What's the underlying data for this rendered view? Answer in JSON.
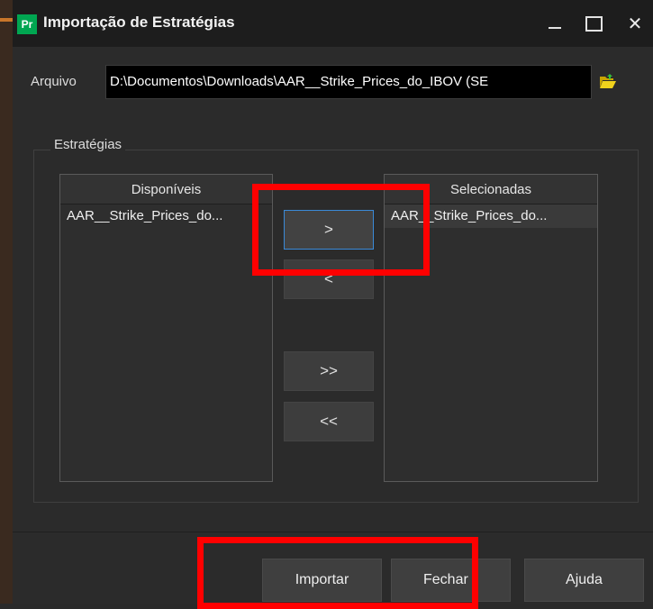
{
  "window": {
    "app_icon": "Pr",
    "title": "Importação de Estratégias"
  },
  "file": {
    "label": "Arquivo",
    "value": "D:\\Documentos\\Downloads\\AAR__Strike_Prices_do_IBOV (SE",
    "browse_icon": "folder-open-icon"
  },
  "strategies": {
    "group_title": "Estratégias",
    "available": {
      "header": "Disponíveis",
      "items": [
        "AAR__Strike_Prices_do..."
      ]
    },
    "selected": {
      "header": "Selecionadas",
      "items": [
        "AAR__Strike_Prices_do..."
      ]
    },
    "buttons": {
      "add": ">",
      "remove": "<",
      "add_all": ">>",
      "remove_all": "<<"
    }
  },
  "footer": {
    "import": "Importar",
    "close": "Fechar",
    "help": "Ajuda"
  },
  "colors": {
    "highlight": "#ff0000",
    "focus_border": "#3a8ad8",
    "app_icon_bg": "#00a651"
  }
}
